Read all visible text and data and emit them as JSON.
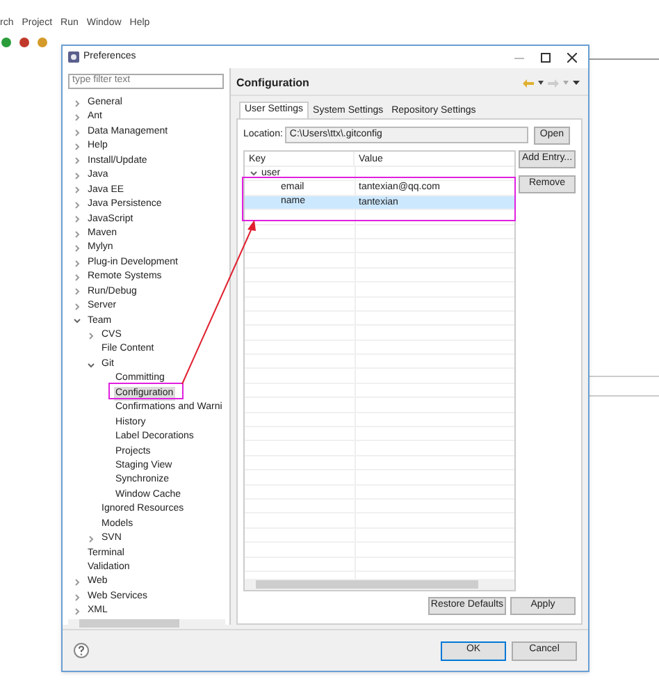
{
  "background_app": {
    "menu": [
      "rch",
      "Project",
      "Run",
      "Window",
      "Help"
    ]
  },
  "dialog": {
    "title": "Preferences",
    "filter": {
      "placeholder": "type filter text"
    },
    "tree": [
      {
        "label": "General",
        "expanded": false
      },
      {
        "label": "Ant",
        "expanded": false
      },
      {
        "label": "Data Management",
        "expanded": false
      },
      {
        "label": "Help",
        "expanded": false
      },
      {
        "label": "Install/Update",
        "expanded": false
      },
      {
        "label": "Java",
        "expanded": false
      },
      {
        "label": "Java EE",
        "expanded": false
      },
      {
        "label": "Java Persistence",
        "expanded": false
      },
      {
        "label": "JavaScript",
        "expanded": false
      },
      {
        "label": "Maven",
        "expanded": false
      },
      {
        "label": "Mylyn",
        "expanded": false
      },
      {
        "label": "Plug-in Development",
        "expanded": false
      },
      {
        "label": "Remote Systems",
        "expanded": false
      },
      {
        "label": "Run/Debug",
        "expanded": false
      },
      {
        "label": "Server",
        "expanded": false
      },
      {
        "label": "Team",
        "expanded": true,
        "children": [
          {
            "label": "CVS",
            "expanded": false
          },
          {
            "label": "File Content"
          },
          {
            "label": "Git",
            "expanded": true,
            "children": [
              {
                "label": "Committing",
                "selected": false
              },
              {
                "label": "Configuration",
                "selected": true
              },
              {
                "label": "Confirmations and Warni",
                "selected": false
              },
              {
                "label": "History",
                "selected": false
              },
              {
                "label": "Label Decorations",
                "selected": false
              },
              {
                "label": "Projects",
                "selected": false
              },
              {
                "label": "Staging View",
                "selected": false
              },
              {
                "label": "Synchronize",
                "selected": false
              },
              {
                "label": "Window Cache",
                "selected": false
              }
            ]
          },
          {
            "label": "Ignored Resources"
          },
          {
            "label": "Models"
          },
          {
            "label": "SVN",
            "expanded": false
          }
        ]
      },
      {
        "label": "Terminal"
      },
      {
        "label": "Validation"
      },
      {
        "label": "Web",
        "expanded": false
      },
      {
        "label": "Web Services",
        "expanded": false
      },
      {
        "label": "XML",
        "expanded": false
      }
    ],
    "page_title": "Configuration",
    "tabs": [
      {
        "label": "User Settings",
        "selected": true
      },
      {
        "label": "System Settings",
        "selected": false
      },
      {
        "label": "Repository Settings",
        "selected": false
      }
    ],
    "location": {
      "label": "Location:",
      "value": "C:\\Users\\ttx\\.gitconfig",
      "button": "Open"
    },
    "table": {
      "columns": [
        "Key",
        "Value"
      ],
      "rows": [
        {
          "key": "user",
          "value": "",
          "expanded": true,
          "selected": false
        },
        {
          "key": "email",
          "value": "tantexian@qq.com",
          "selected": false
        },
        {
          "key": "name",
          "value": "tantexian",
          "selected": true
        }
      ]
    },
    "side_buttons": [
      "Add Entry...",
      "Remove"
    ],
    "page_buttons": [
      "Restore Defaults",
      "Apply"
    ],
    "buttons": [
      {
        "label": "OK",
        "default": true
      },
      {
        "label": "Cancel",
        "default": false
      }
    ]
  }
}
